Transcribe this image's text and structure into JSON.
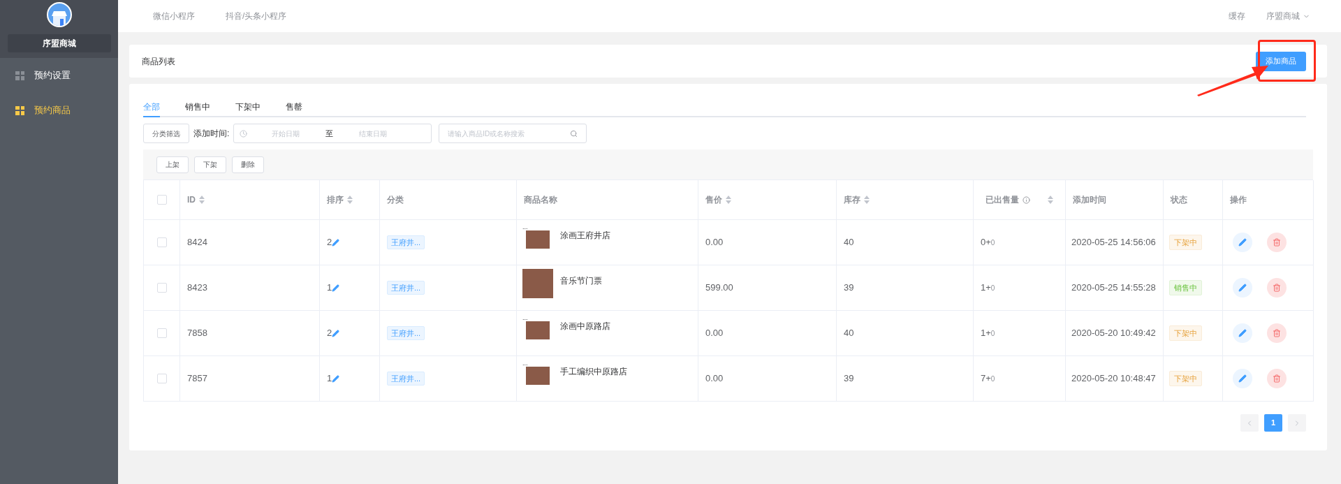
{
  "sidebar": {
    "shop_name": "序盟商城",
    "items": [
      {
        "label": "预约设置",
        "selected": false
      },
      {
        "label": "预约商品",
        "selected": true
      }
    ]
  },
  "top_bar": {
    "links": [
      "微信小程序",
      "抖音/头条小程序"
    ],
    "cache": "缓存",
    "account": "序盟商城"
  },
  "header_card": {
    "title": "商品列表",
    "add_button": "添加商品"
  },
  "tabs": [
    {
      "label": "全部",
      "selected": true
    },
    {
      "label": "销售中",
      "selected": false
    },
    {
      "label": "下架中",
      "selected": false
    },
    {
      "label": "售罄",
      "selected": false
    }
  ],
  "filters": {
    "category_button": "分类筛选",
    "date_label": "添加时间:",
    "start_placeholder": "开始日期",
    "separator": "至",
    "end_placeholder": "结束日期",
    "search_placeholder": "请输入商品ID或名称搜索"
  },
  "batch_buttons": [
    "上架",
    "下架",
    "删除"
  ],
  "table": {
    "header_checked": false,
    "columns": [
      {
        "label": "ID",
        "sortable": true,
        "info": false
      },
      {
        "label": "排序",
        "sortable": true,
        "info": false
      },
      {
        "label": "分类",
        "sortable": false,
        "info": false
      },
      {
        "label": "商品名称",
        "sortable": false,
        "info": false
      },
      {
        "label": "售价",
        "sortable": true,
        "info": false
      },
      {
        "label": "库存",
        "sortable": true,
        "info": false
      },
      {
        "label": "已出售量",
        "sortable": true,
        "info": true
      },
      {
        "label": "添加时间",
        "sortable": false,
        "info": false
      },
      {
        "label": "状态",
        "sortable": false,
        "info": false
      },
      {
        "label": "操作",
        "sortable": false,
        "info": false
      }
    ],
    "rows": [
      {
        "checked": false,
        "id": "8424",
        "sort": "2",
        "category": "王府井...",
        "image_note": "...",
        "name": "涂画王府井店",
        "price": "0.00",
        "stock": "40",
        "sold": "0+",
        "sold_extra": "0",
        "added": "2020-05-25 14:56:06",
        "status": {
          "kind": "off",
          "label": "下架中"
        }
      },
      {
        "checked": false,
        "id": "8423",
        "sort": "1",
        "category": "王府井...",
        "name": "音乐节门票",
        "price": "599.00",
        "stock": "39",
        "sold": "1+",
        "sold_extra": "0",
        "added": "2020-05-25 14:55:28",
        "status": {
          "kind": "on",
          "label": "销售中"
        }
      },
      {
        "checked": false,
        "id": "7858",
        "sort": "2",
        "category": "王府井...",
        "image_note": "...",
        "name": "涂画中原路店",
        "price": "0.00",
        "stock": "40",
        "sold": "1+",
        "sold_extra": "0",
        "added": "2020-05-20 10:49:42",
        "status": {
          "kind": "off",
          "label": "下架中"
        }
      },
      {
        "checked": false,
        "id": "7857",
        "sort": "1",
        "category": "王府井...",
        "image_note": "...",
        "name": "手工编织中原路店",
        "price": "0.00",
        "stock": "39",
        "sold": "7+",
        "sold_extra": "0",
        "added": "2020-05-20 10:48:47",
        "status": {
          "kind": "off",
          "label": "下架中"
        }
      }
    ]
  },
  "pagination": {
    "pages": [
      {
        "label": "1",
        "selected": true
      }
    ]
  }
}
